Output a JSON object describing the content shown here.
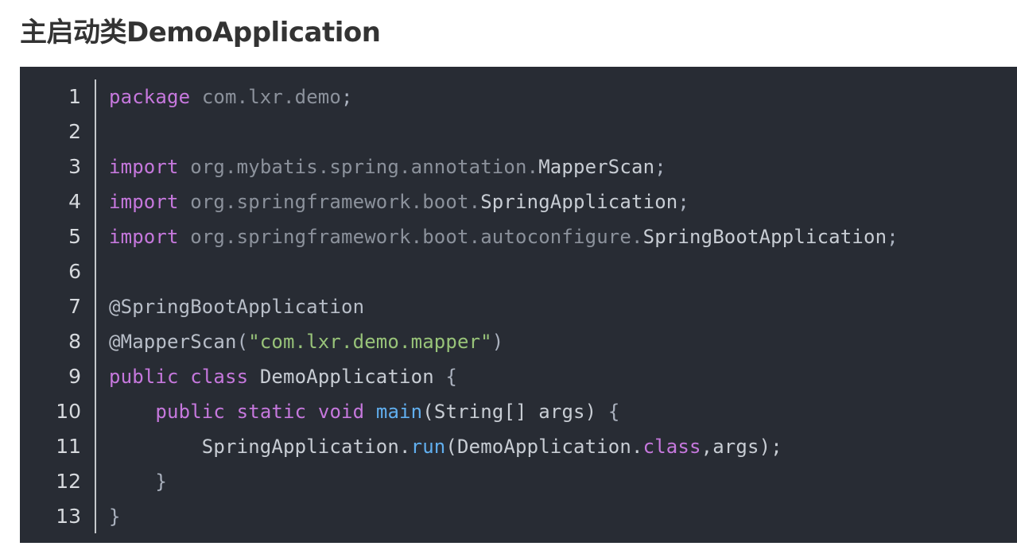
{
  "page": {
    "title": "主启动类DemoApplication"
  },
  "code_block": {
    "language": "java",
    "lines": [
      {
        "number": "1",
        "tokens": [
          {
            "t": "package",
            "k": "keyword"
          },
          {
            "t": " ",
            "k": "plain"
          },
          {
            "t": "com.lxr.demo",
            "k": "pkg"
          },
          {
            "t": ";",
            "k": "punct"
          }
        ]
      },
      {
        "number": "2",
        "tokens": []
      },
      {
        "number": "3",
        "tokens": [
          {
            "t": "import",
            "k": "keyword"
          },
          {
            "t": " ",
            "k": "plain"
          },
          {
            "t": "org.mybatis.spring.annotation.",
            "k": "pkg"
          },
          {
            "t": "MapperScan",
            "k": "plain"
          },
          {
            "t": ";",
            "k": "punct"
          }
        ]
      },
      {
        "number": "4",
        "tokens": [
          {
            "t": "import",
            "k": "keyword"
          },
          {
            "t": " ",
            "k": "plain"
          },
          {
            "t": "org.springframework.boot.",
            "k": "pkg"
          },
          {
            "t": "SpringApplication",
            "k": "plain"
          },
          {
            "t": ";",
            "k": "punct"
          }
        ]
      },
      {
        "number": "5",
        "tokens": [
          {
            "t": "import",
            "k": "keyword"
          },
          {
            "t": " ",
            "k": "plain"
          },
          {
            "t": "org.springframework.boot.autoconfigure.",
            "k": "pkg"
          },
          {
            "t": "SpringBootApplication",
            "k": "plain"
          },
          {
            "t": ";",
            "k": "punct"
          }
        ]
      },
      {
        "number": "6",
        "tokens": []
      },
      {
        "number": "7",
        "tokens": [
          {
            "t": "@SpringBootApplication",
            "k": "annot"
          }
        ]
      },
      {
        "number": "8",
        "tokens": [
          {
            "t": "@MapperScan",
            "k": "annot"
          },
          {
            "t": "(",
            "k": "punct"
          },
          {
            "t": "\"com.lxr.demo.mapper\"",
            "k": "string"
          },
          {
            "t": ")",
            "k": "punct"
          }
        ]
      },
      {
        "number": "9",
        "tokens": [
          {
            "t": "public",
            "k": "keyword"
          },
          {
            "t": " ",
            "k": "plain"
          },
          {
            "t": "class",
            "k": "keyword"
          },
          {
            "t": " DemoApplication ",
            "k": "plain"
          },
          {
            "t": "{",
            "k": "punct"
          }
        ]
      },
      {
        "number": "10",
        "tokens": [
          {
            "t": "    ",
            "k": "plain"
          },
          {
            "t": "public",
            "k": "keyword"
          },
          {
            "t": " ",
            "k": "plain"
          },
          {
            "t": "static",
            "k": "keyword"
          },
          {
            "t": " ",
            "k": "plain"
          },
          {
            "t": "void",
            "k": "keyword"
          },
          {
            "t": " ",
            "k": "plain"
          },
          {
            "t": "main",
            "k": "func"
          },
          {
            "t": "(String[] args) ",
            "k": "plain"
          },
          {
            "t": "{",
            "k": "punct"
          }
        ]
      },
      {
        "number": "11",
        "tokens": [
          {
            "t": "        ",
            "k": "plain"
          },
          {
            "t": "SpringApplication.",
            "k": "plain"
          },
          {
            "t": "run",
            "k": "func"
          },
          {
            "t": "(DemoApplication.",
            "k": "plain"
          },
          {
            "t": "class",
            "k": "keyword"
          },
          {
            "t": ",args);",
            "k": "plain"
          }
        ]
      },
      {
        "number": "12",
        "tokens": [
          {
            "t": "    ",
            "k": "plain"
          },
          {
            "t": "}",
            "k": "punct"
          }
        ]
      },
      {
        "number": "13",
        "tokens": [
          {
            "t": "}",
            "k": "punct"
          }
        ]
      }
    ]
  },
  "colors": {
    "background": "#282c34",
    "keyword": "#c678dd",
    "function": "#61afef",
    "string": "#98c379",
    "package": "#8c929c",
    "text": "#c8cdd4",
    "line_number": "#d6d9dd",
    "title": "#333333"
  }
}
